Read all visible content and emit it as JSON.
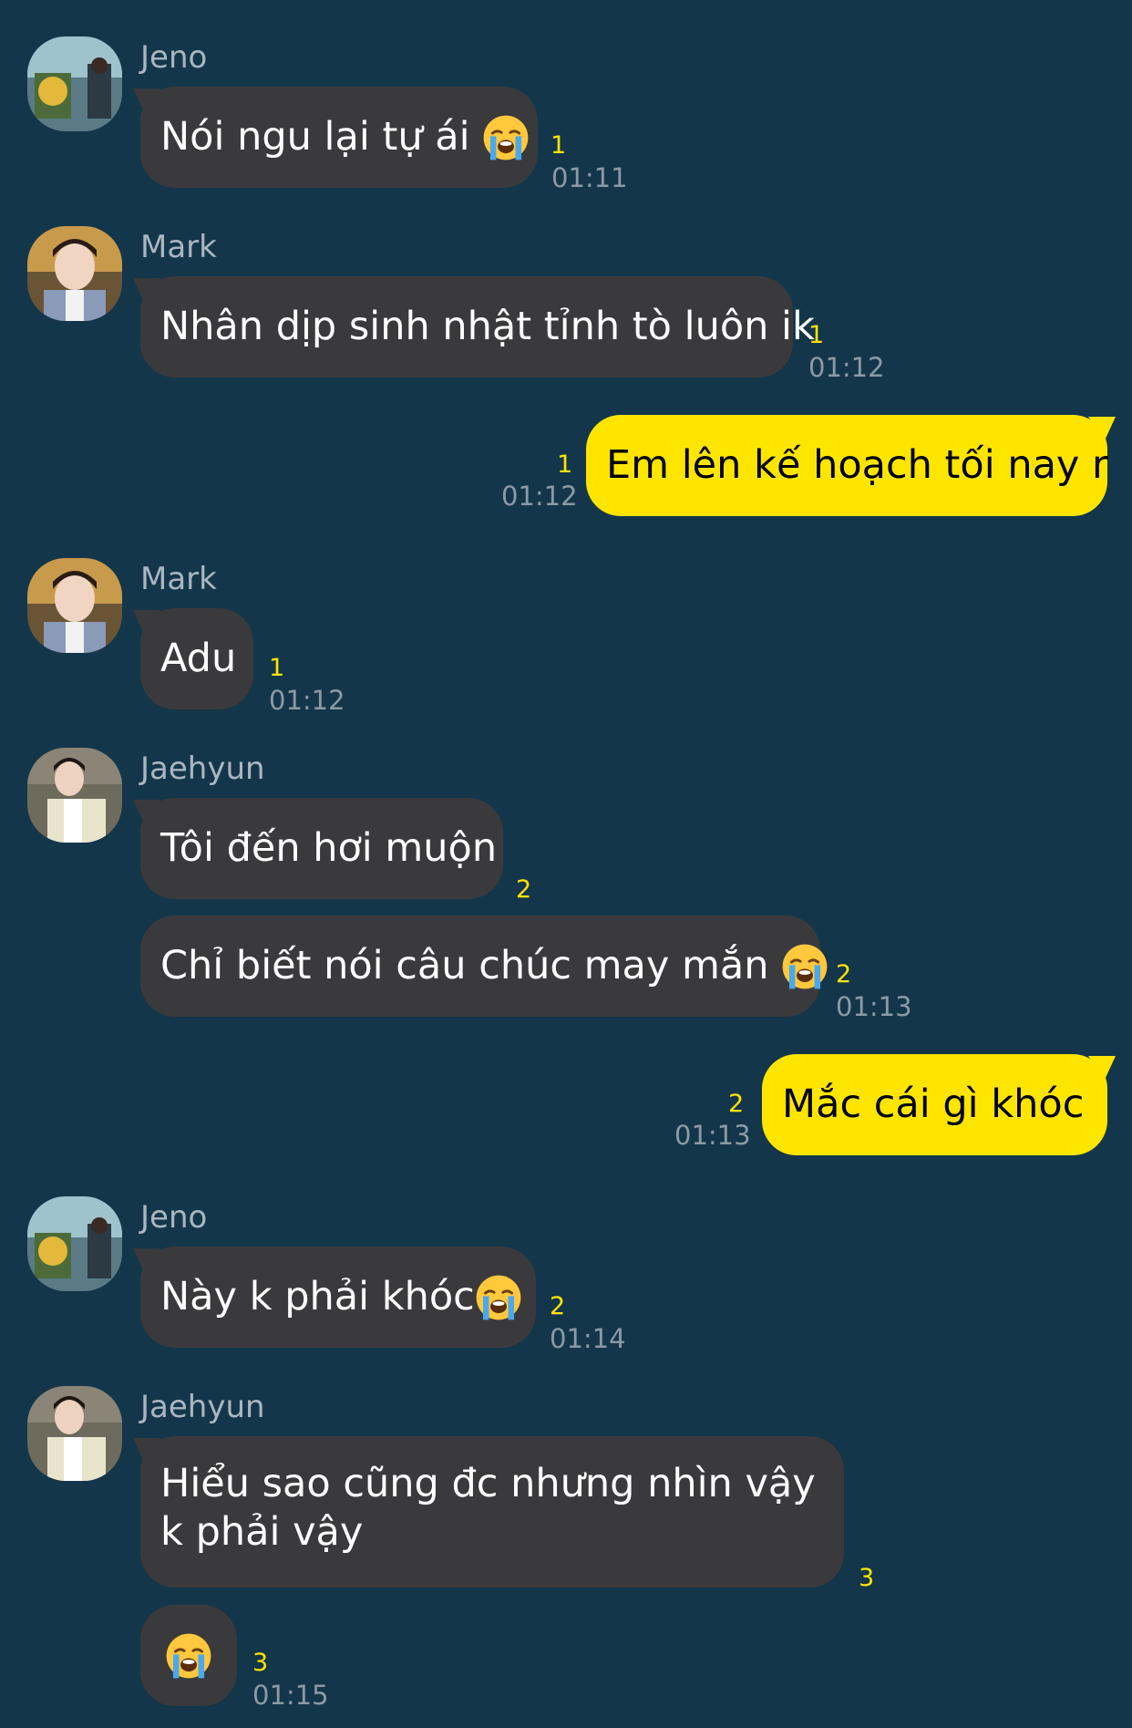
{
  "users": {
    "jeno": "Jeno",
    "mark": "Mark",
    "jaehyun": "Jaehyun"
  },
  "messages": [
    {
      "sender": "Jeno",
      "text": "Nói ngu lại tự ái",
      "emoji": "loudly-crying-face",
      "unread": "1",
      "time": "01:11"
    },
    {
      "sender": "Mark",
      "text": "Nhân dịp sinh nhật tỉnh tò luôn ik",
      "unread": "1",
      "time": "01:12"
    },
    {
      "sender": "me",
      "text": "Em lên kế hoạch tối nay r",
      "unread": "1",
      "time": "01:12"
    },
    {
      "sender": "Mark",
      "text": "Adu",
      "unread": "1",
      "time": "01:12"
    },
    {
      "sender": "Jaehyun",
      "text": "Tôi đến hơi muộn",
      "unread": "2"
    },
    {
      "sender": "Jaehyun",
      "text": "Chỉ biết nói câu chúc may mắn",
      "emoji": "loudly-crying-face",
      "unread": "2",
      "time": "01:13"
    },
    {
      "sender": "me",
      "text": "Mắc cái gì khóc",
      "unread": "2",
      "time": "01:13"
    },
    {
      "sender": "Jeno",
      "text": "Này k phải khóc",
      "emoji": "loudly-crying-face",
      "unread": "2",
      "time": "01:14"
    },
    {
      "sender": "Jaehyun",
      "text": "Hiểu sao cũng đc nhưng nhìn vậy k phải vậy",
      "unread": "3"
    },
    {
      "sender": "Jaehyun",
      "text": "",
      "emoji": "loudly-crying-face",
      "unread": "3",
      "time": "01:15"
    }
  ],
  "colors": {
    "background": "#14364a",
    "incoming_bubble": "#3a3a3c",
    "outgoing_bubble": "#fee500",
    "unread_count": "#fee500",
    "timestamp": "#8b9aa7"
  }
}
